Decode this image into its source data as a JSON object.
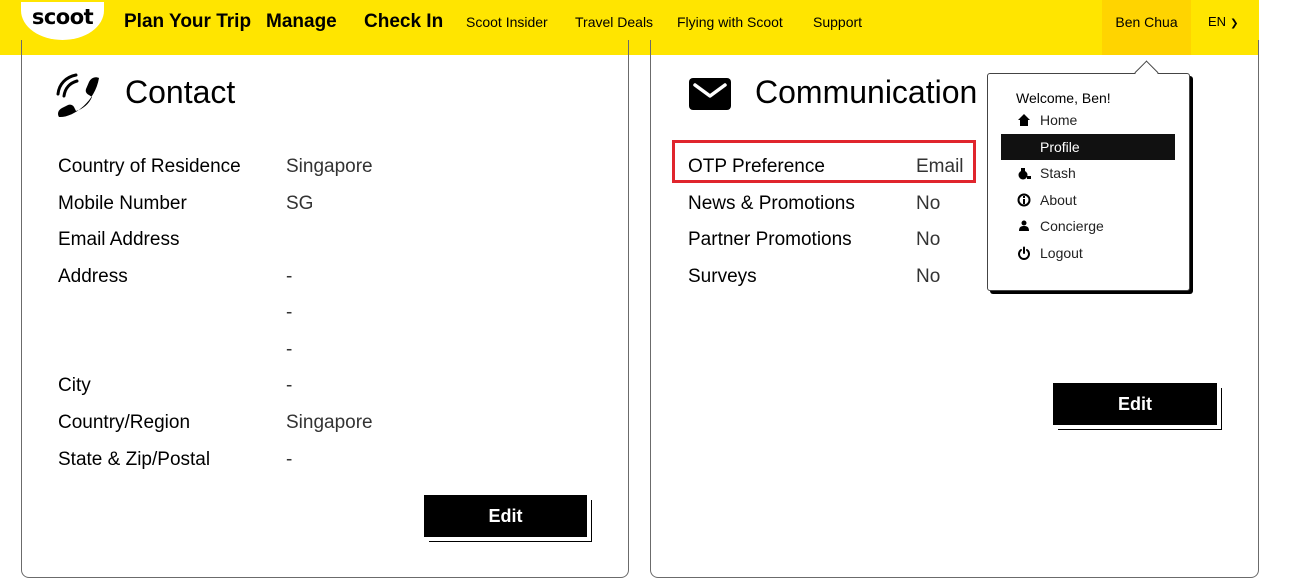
{
  "header": {
    "logo": "scoot",
    "nav_main": [
      "Plan Your Trip",
      "Manage",
      "Check In"
    ],
    "nav_small": [
      "Scoot Insider",
      "Travel Deals",
      "Flying with Scoot",
      "Support"
    ],
    "user_name": "Ben Chua",
    "language": "EN"
  },
  "contact": {
    "title": "Contact",
    "icon": "phone-icon",
    "rows": [
      {
        "label": "Country of Residence",
        "value": "Singapore"
      },
      {
        "label": "Mobile Number",
        "value": "SG"
      },
      {
        "label": "Email Address",
        "value": ""
      },
      {
        "label": "Address",
        "value": "-"
      },
      {
        "label": "",
        "value": "-"
      },
      {
        "label": "",
        "value": "-"
      },
      {
        "label": "City",
        "value": "-"
      },
      {
        "label": "Country/Region",
        "value": "Singapore"
      },
      {
        "label": "State & Zip/Postal",
        "value": "-"
      }
    ],
    "edit_label": "Edit"
  },
  "communication": {
    "title": "Communication",
    "icon": "mail-icon",
    "rows": [
      {
        "label": "OTP Preference",
        "value": "Email"
      },
      {
        "label": "News & Promotions",
        "value": "No"
      },
      {
        "label": "Partner Promotions",
        "value": "No"
      },
      {
        "label": "Surveys",
        "value": "No"
      }
    ],
    "edit_label": "Edit",
    "highlight_color": "#e0252d"
  },
  "user_menu": {
    "welcome": "Welcome, Ben!",
    "items": [
      {
        "label": "Home",
        "icon": "home-icon",
        "active": false
      },
      {
        "label": "Profile",
        "icon": "",
        "active": true
      },
      {
        "label": "Stash",
        "icon": "money-bag-icon",
        "active": false
      },
      {
        "label": "About",
        "icon": "info-icon",
        "active": false
      },
      {
        "label": "Concierge",
        "icon": "concierge-icon",
        "active": false
      },
      {
        "label": "Logout",
        "icon": "power-icon",
        "active": false
      }
    ]
  },
  "colors": {
    "brand_yellow": "#ffe500",
    "user_tab": "#ffd400",
    "button": "#000000"
  }
}
